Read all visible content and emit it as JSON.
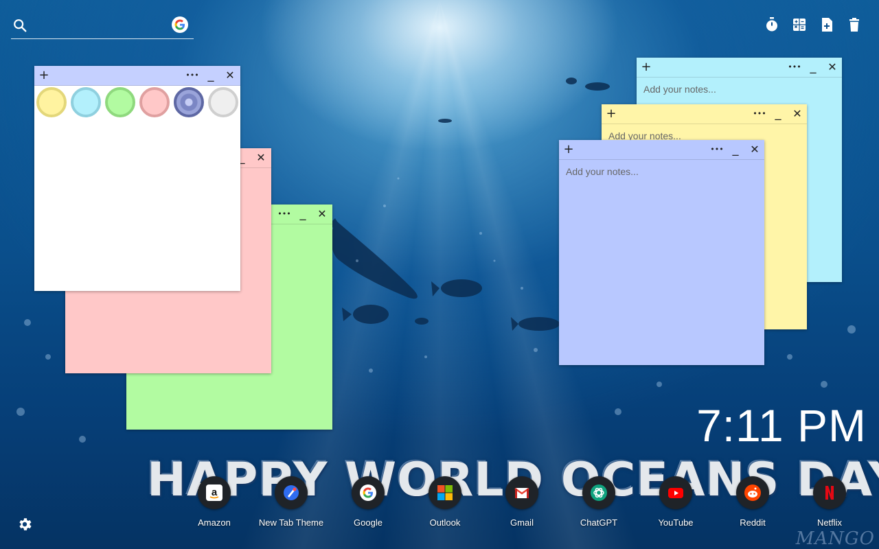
{
  "search": {
    "placeholder": "",
    "icon": "search-icon",
    "engine_icon": "google-icon"
  },
  "toolbar": {
    "icons": [
      "timer-icon",
      "calculator-icon",
      "add-note-icon",
      "trash-icon"
    ]
  },
  "notes": [
    {
      "id": "note-cyan",
      "color": "#b3f0fc",
      "placeholder": "Add your notes..."
    },
    {
      "id": "note-yellow",
      "color": "#fff5a8",
      "placeholder": "Add your notes..."
    },
    {
      "id": "note-blue",
      "color": "#b8c8ff",
      "placeholder": "Add your notes..."
    },
    {
      "id": "note-green",
      "color": "#b2fba1",
      "placeholder": ""
    },
    {
      "id": "note-pink",
      "color": "#ffc8c8",
      "placeholder": ""
    },
    {
      "id": "note-white",
      "color": "#ffffff",
      "placeholder": ""
    }
  ],
  "note_controls": {
    "add": "+",
    "more": "•••",
    "minimize": "_",
    "close": "✕"
  },
  "color_swatches": [
    {
      "name": "yellow",
      "fill": "#fff3a0",
      "ring": "#e3d77a"
    },
    {
      "name": "cyan",
      "fill": "#b3f0fc",
      "ring": "#8fd0df"
    },
    {
      "name": "green",
      "fill": "#b2fba1",
      "ring": "#8fd97e"
    },
    {
      "name": "pink",
      "fill": "#ffc8c8",
      "ring": "#e0a0a0"
    },
    {
      "name": "periwinkle",
      "fill": "#7b86c4",
      "ring": "#5e68a4"
    },
    {
      "name": "white",
      "fill": "#efefef",
      "ring": "#cfcfcf"
    }
  ],
  "clock": {
    "time": "7:11 PM"
  },
  "banner": {
    "text": "HAPPY WORLD OCEANS DAY"
  },
  "shortcuts": [
    {
      "label": "Amazon",
      "icon": "amazon-icon"
    },
    {
      "label": "New Tab Theme",
      "icon": "new-tab-theme-icon"
    },
    {
      "label": "Google",
      "icon": "google-icon"
    },
    {
      "label": "Outlook",
      "icon": "outlook-icon"
    },
    {
      "label": "Gmail",
      "icon": "gmail-icon"
    },
    {
      "label": "ChatGPT",
      "icon": "chatgpt-icon"
    },
    {
      "label": "YouTube",
      "icon": "youtube-icon"
    },
    {
      "label": "Reddit",
      "icon": "reddit-icon"
    },
    {
      "label": "Netflix",
      "icon": "netflix-icon"
    }
  ],
  "settings": {
    "icon": "gear-icon"
  },
  "watermark": {
    "text": "MANGO"
  }
}
